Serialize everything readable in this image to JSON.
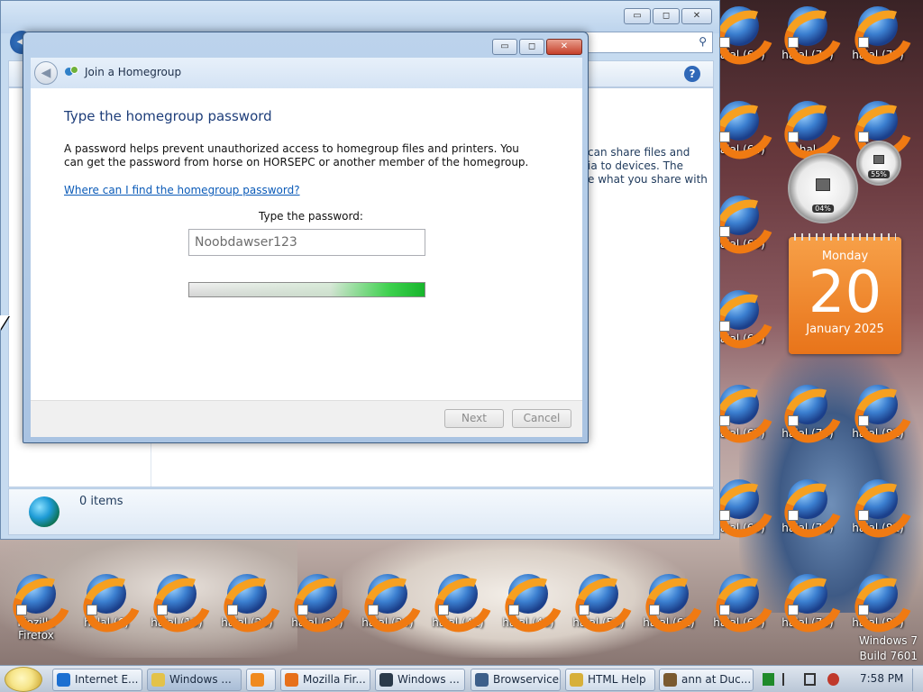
{
  "explorer": {
    "body_text": "can share files and\nia to devices. The\ne what you share with",
    "items_count": "0 items"
  },
  "dialog": {
    "title": "Join a Homegroup",
    "heading": "Type the homegroup password",
    "description": "A password helps prevent unauthorized access to homegroup files and printers. You can get the password from horse on HORSEPC or another member of the homegroup.",
    "help_link": "Where can I find the homegroup password?",
    "password_label": "Type the password:",
    "password_value": "Noobdawser123",
    "progress_fraction": 1.0,
    "next_label": "Next",
    "cancel_label": "Cancel",
    "minimize_glyph": "▭",
    "maximize_glyph": "◻",
    "close_glyph": "✕"
  },
  "explorer_buttons": {
    "minimize_glyph": "▭",
    "maximize_glyph": "◻",
    "close_glyph": "✕"
  },
  "desktop_icons": {
    "right_columns": [
      [
        "halal (63)",
        "halal (70)",
        "halal (77)"
      ],
      [
        "halal (64)",
        "hal",
        ""
      ],
      [
        "halal (65)",
        "",
        ""
      ],
      [
        "halal (66)",
        "",
        ""
      ],
      [
        "halal (67)",
        "halal (74)",
        "halal (81)"
      ],
      [
        "halal (68)",
        "halal (75)",
        "halal (82)"
      ],
      [
        "halal (69)",
        "halal (76)",
        "halal (83)"
      ]
    ],
    "bottom_row": [
      "Mozilla Firefox",
      "halal (6)",
      "halal (13)",
      "halal (20)",
      "halal (27)",
      "halal (34)",
      "halal (41)",
      "halal (48)",
      "halal (55)",
      "halal (62)"
    ]
  },
  "gadgets": {
    "cpu_percent": "04%",
    "memory_percent": "55%",
    "calendar_weekday": "Monday",
    "calendar_day": "20",
    "calendar_month_year": "January 2025"
  },
  "watermark": {
    "line1": "Windows 7",
    "line2": "Build 7601"
  },
  "taskbar": {
    "buttons": [
      {
        "label": "Internet E...",
        "icon": "ie-icon"
      },
      {
        "label": "Windows ...",
        "icon": "folder-icon"
      },
      {
        "label": "",
        "icon": "media-player-icon"
      },
      {
        "label": "Mozilla Fir...",
        "icon": "firefox-icon"
      },
      {
        "label": "Windows ...",
        "icon": "cmd-icon"
      },
      {
        "label": "Browservice",
        "icon": "app-icon"
      },
      {
        "label": "HTML Help",
        "icon": "help-icon"
      },
      {
        "label": "ann at Duc...",
        "icon": "terminal-icon"
      }
    ],
    "clock": "7:58 PM"
  },
  "colors": {
    "dialog_heading": "#1e3e7a",
    "link": "#0b5bb8",
    "progress_green": "#17b52c",
    "calendar_orange": "#e8741a"
  }
}
